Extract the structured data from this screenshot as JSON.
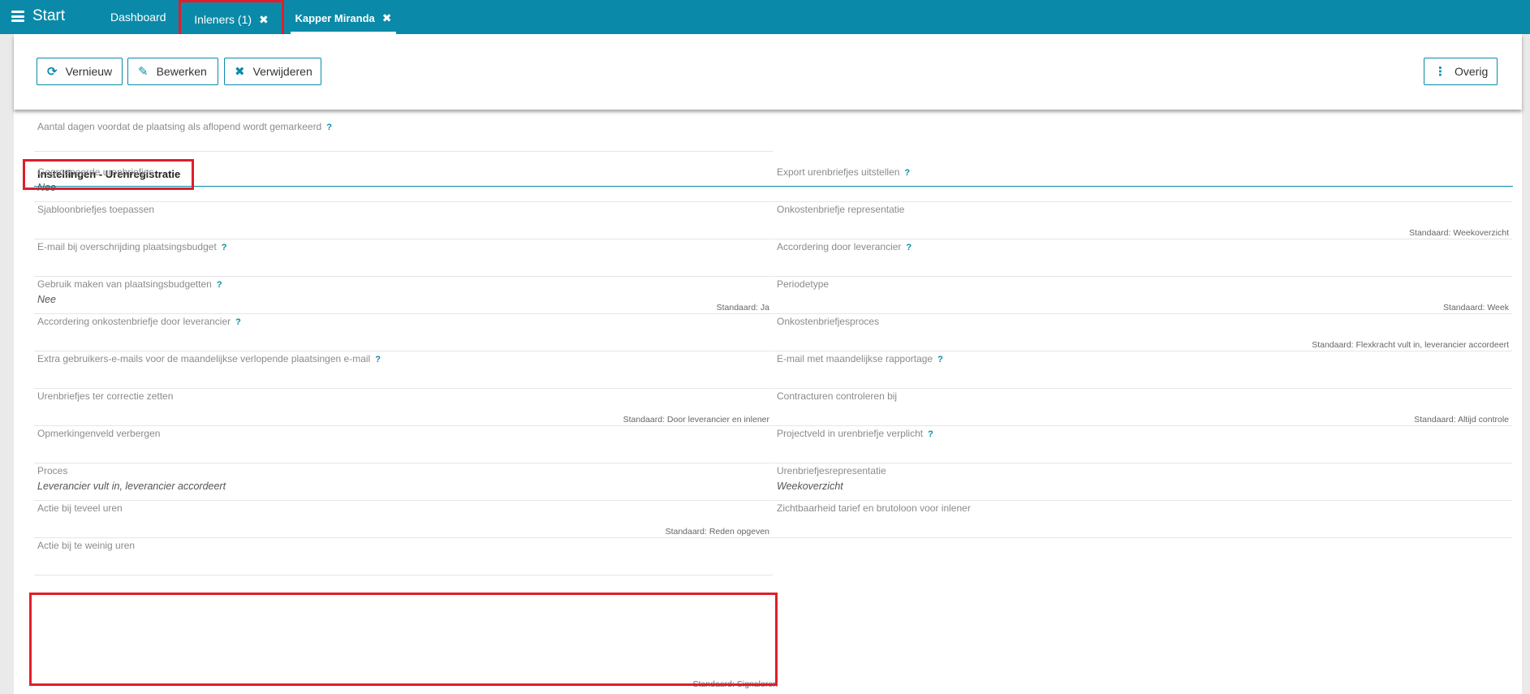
{
  "topbar": {
    "menu_label": "Start",
    "tabs": [
      {
        "label": "Dashboard"
      },
      {
        "label": "Inleners (1)",
        "close": "✖"
      },
      {
        "label": "Kapper Miranda",
        "close": "✖"
      }
    ]
  },
  "toolbar": {
    "refresh_label": "Vernieuw",
    "edit_label": "Bewerken",
    "delete_label": "Verwijderen",
    "other_label": "Overig"
  },
  "top_field": {
    "label": "Aantal dagen voordat de plaatsing als aflopend wordt gemarkeerd",
    "help": "?"
  },
  "section": {
    "title": "Instellingen - Urenregistratie"
  },
  "left_fields": [
    {
      "label": "Gegroepeerde urenbriefjes",
      "help": "",
      "value": "Nee",
      "std": ""
    },
    {
      "label": "Sjabloonbriefjes toepassen",
      "help": "",
      "value": "",
      "std": ""
    },
    {
      "label": "E-mail bij overschrijding plaatsingsbudget",
      "help": "?",
      "value": "",
      "std": ""
    },
    {
      "label": "Gebruik maken van plaatsingsbudgetten",
      "help": "?",
      "value": "Nee",
      "std": ""
    },
    {
      "label": "Accordering onkostenbriefje door leverancier",
      "help": "?",
      "value": "",
      "std": "Standaard: Ja"
    },
    {
      "label": "Extra gebruikers-e-mails voor de maandelijkse verlopende plaatsingen e-mail",
      "help": "?",
      "value": "",
      "std": ""
    },
    {
      "label": "Urenbriefjes ter correctie zetten",
      "help": "",
      "value": "",
      "std": ""
    },
    {
      "label": "Opmerkingenveld verbergen",
      "help": "",
      "value": "",
      "std": "Standaard: Door leverancier en inlener"
    },
    {
      "label": "Proces",
      "help": "",
      "value": "Leverancier vult in, leverancier accordeert",
      "std": ""
    },
    {
      "label": "Actie bij teveel uren",
      "help": "",
      "value": "",
      "std": ""
    },
    {
      "label": "Actie bij te weinig uren",
      "help": "",
      "value": "",
      "std": "Standaard: Reden opgeven"
    }
  ],
  "left_footer_std": "Standaard: Signaleren",
  "right_fields": [
    {
      "label": "Export urenbriefjes uitstellen",
      "help": "?",
      "value": "",
      "std": ""
    },
    {
      "label": "Onkostenbriefje representatie",
      "help": "",
      "value": "",
      "std": ""
    },
    {
      "label": "Accordering door leverancier",
      "help": "?",
      "value": "",
      "std": "Standaard: Weekoverzicht"
    },
    {
      "label": "Periodetype",
      "help": "",
      "value": "",
      "std": ""
    },
    {
      "label": "Onkostenbriefjesproces",
      "help": "",
      "value": "",
      "std": "Standaard: Week"
    },
    {
      "label": "E-mail met maandelijkse rapportage",
      "help": "?",
      "value": "",
      "std": "Standaard: Flexkracht vult in, leverancier accordeert"
    },
    {
      "label": "Contracturen controleren bij",
      "help": "",
      "value": "",
      "std": ""
    },
    {
      "label": "Projectveld in urenbriefje verplicht",
      "help": "?",
      "value": "",
      "std": "Standaard: Altijd controle"
    },
    {
      "label": "Urenbriefjesrepresentatie",
      "help": "",
      "value": "Weekoverzicht",
      "std": ""
    },
    {
      "label": "Zichtbaarheid tarief en brutoloon voor inlener",
      "help": "",
      "value": "",
      "std": ""
    }
  ]
}
